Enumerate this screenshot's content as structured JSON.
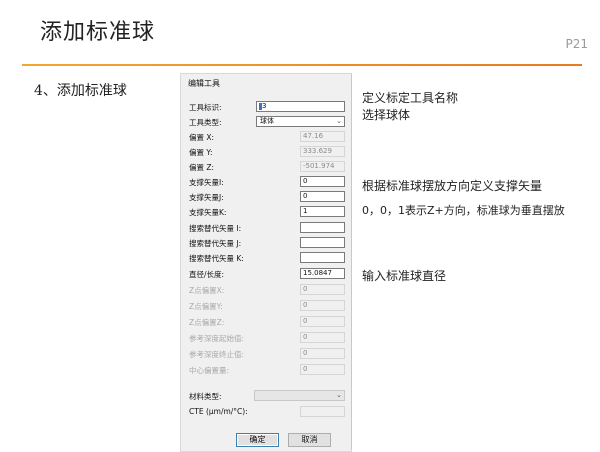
{
  "slide": {
    "title": "添加标准球",
    "page_number": "P21",
    "section": "4、添加标准球",
    "accent_color": "#f0a830"
  },
  "dialog": {
    "title": "编辑工具",
    "fields": {
      "tool_id": {
        "label": "工具标识:",
        "value": "3"
      },
      "tool_type": {
        "label": "工具类型:",
        "value": "球体"
      },
      "offset_x": {
        "label": "偏置 X:",
        "value": "47.16"
      },
      "offset_y": {
        "label": "偏置 Y:",
        "value": "333.629"
      },
      "offset_z": {
        "label": "偏置 Z:",
        "value": "-501.974"
      },
      "support_i": {
        "label": "支撑矢量I:",
        "value": "0"
      },
      "support_j": {
        "label": "支撑矢量J:",
        "value": "0"
      },
      "support_k": {
        "label": "支撑矢量K:",
        "value": "1"
      },
      "search_i": {
        "label": "搜索替代矢量 I:",
        "value": ""
      },
      "search_j": {
        "label": "搜索替代矢量 J:",
        "value": ""
      },
      "search_k": {
        "label": "搜索替代矢量 K:",
        "value": ""
      },
      "diameter": {
        "label": "直径/长度:",
        "value": "15.0847"
      },
      "z_offset_x": {
        "label": "Z点偏置X:",
        "value": "0"
      },
      "z_offset_y": {
        "label": "Z点偏置Y:",
        "value": "0"
      },
      "z_offset_z": {
        "label": "Z点偏置Z:",
        "value": "0"
      },
      "ref_depth_start": {
        "label": "参考深度起始值:",
        "value": "0"
      },
      "ref_depth_end": {
        "label": "参考深度终止值:",
        "value": "0"
      },
      "center_offset": {
        "label": "中心偏置量:",
        "value": "0"
      },
      "material_type": {
        "label": "材料类型:",
        "value": ""
      },
      "cte": {
        "label": "CTE (μm/m/°C):",
        "value": ""
      }
    },
    "ok_label": "确定",
    "cancel_label": "取消"
  },
  "notes": {
    "name_line1": "定义标定工具名称",
    "name_line2": "选择球体",
    "vector_line1": "根据标准球摆放方向定义支撑矢量",
    "vector_line2": "0，0，1表示Z+方向，标准球为垂直摆放",
    "diameter_line": "输入标准球直径"
  }
}
